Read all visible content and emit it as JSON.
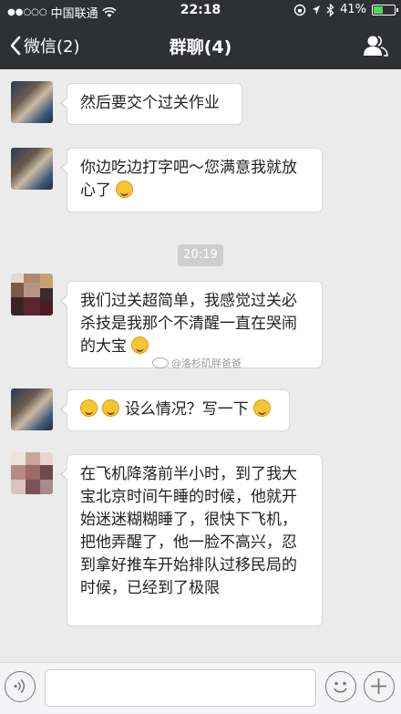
{
  "status_bar": {
    "signal_dots": "●●○○○",
    "carrier": "中国联通",
    "time": "22:18",
    "battery": "41%",
    "battery_level": 0.41
  },
  "nav": {
    "back_label": "微信(2)",
    "title": "群聊(4)"
  },
  "messages": [
    {
      "text": "然后要交个过关作业",
      "emoji": ""
    },
    {
      "text": "你边吃边打字吧～您满意我就放心了",
      "emoji": "smiling-face"
    },
    {
      "text": "我们过关超简单，我感觉过关必杀技是我那个不清醒一直在哭闹的大宝",
      "emoji": "crazy-face"
    },
    {
      "prefix_emojis": [
        "hushed-face",
        "grinning-face"
      ],
      "text": "设么情况？写一下",
      "emoji": "thinking-face"
    },
    {
      "text": "在飞机降落前半小时，到了我大宝北京时间午睡的时候，他就开始迷迷糊糊睡了，很快下飞机，把他弄醒了，他一脸不高兴，忍到拿好推车开始排队过移民局的时候，已经到了极限",
      "emoji": ""
    }
  ],
  "timestamp": "20:19",
  "watermark": "@洛杉矶胖爸爸"
}
